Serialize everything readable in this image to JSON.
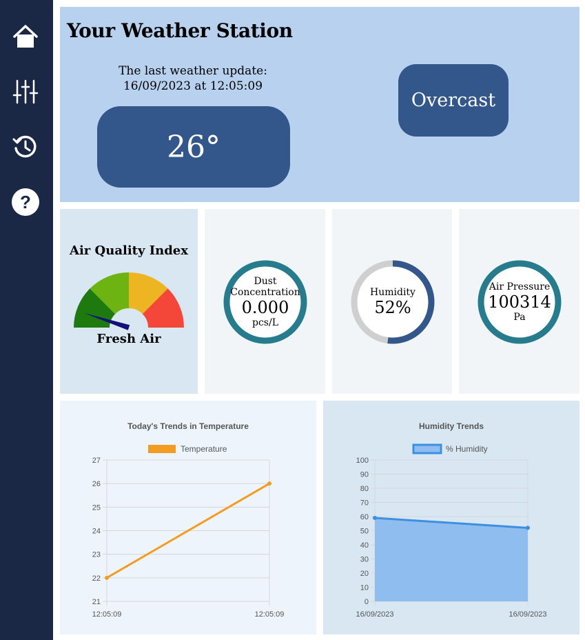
{
  "sidebar": {
    "items": [
      {
        "name": "home-icon"
      },
      {
        "name": "sliders-icon"
      },
      {
        "name": "history-icon"
      },
      {
        "name": "help-icon"
      }
    ]
  },
  "header": {
    "title": "Your Weather Station",
    "update_line1": "The last weather update:",
    "update_line2": "16/09/2023 at 12:05:09",
    "temperature": "26°",
    "condition": "Overcast"
  },
  "air_quality": {
    "title": "Air Quality Index",
    "status": "Fresh Air",
    "segment_colors": [
      "#1e7a0f",
      "#6db413",
      "#edb522",
      "#f4473a"
    ],
    "needle_color": "#14107a",
    "level": 0.1
  },
  "dust": {
    "label_line1": "Dust",
    "label_line2": "Concentration",
    "value": "0.000",
    "unit": "pcs/L",
    "ring_color": "#267b8c"
  },
  "humidity": {
    "label": "Humidity",
    "value": "52%",
    "fraction": 0.52,
    "fill_color": "#33578a",
    "track_color": "#cfcfcf"
  },
  "pressure": {
    "label": "Air Pressure",
    "value": "100314",
    "unit": "Pa",
    "ring_color": "#267b8c"
  },
  "chart_data": [
    {
      "type": "line",
      "title": "Today's Trends in Temperature",
      "x": [
        "12:05:09",
        "12:05:09"
      ],
      "series": [
        {
          "name": "Temperature",
          "values": [
            22,
            26
          ],
          "color": "#f29d22"
        }
      ],
      "ylim": [
        21,
        27
      ],
      "yticks": [
        21,
        22,
        23,
        24,
        25,
        26,
        27
      ],
      "grid": true,
      "legend": "top"
    },
    {
      "type": "area",
      "title": "Humidity Trends",
      "x": [
        "16/09/2023",
        "16/09/2023"
      ],
      "series": [
        {
          "name": "% Humidity",
          "values": [
            59,
            52
          ],
          "color": "#3d8fe2"
        }
      ],
      "ylim": [
        0,
        100
      ],
      "yticks": [
        0,
        10,
        20,
        30,
        40,
        50,
        60,
        70,
        80,
        90,
        100
      ],
      "grid": true,
      "legend": "top"
    }
  ]
}
